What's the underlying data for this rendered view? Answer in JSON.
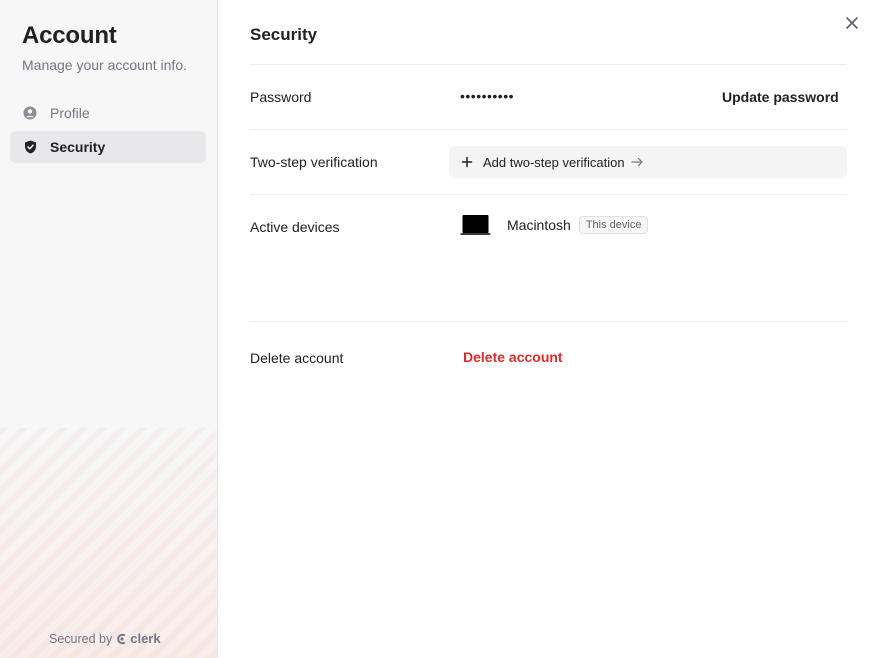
{
  "sidebar": {
    "title": "Account",
    "subtitle": "Manage your account info.",
    "items": [
      {
        "label": "Profile",
        "icon": "user-circle-icon",
        "active": false
      },
      {
        "label": "Security",
        "icon": "shield-icon",
        "active": true
      }
    ],
    "footer": {
      "prefix": "Secured by",
      "brand": "clerk"
    }
  },
  "main": {
    "title": "Security",
    "password": {
      "label": "Password",
      "value": "••••••••••",
      "action": "Update password"
    },
    "two_step": {
      "label": "Two-step verification",
      "action": "Add two-step verification"
    },
    "devices": {
      "label": "Active devices",
      "items": [
        {
          "name": "Macintosh",
          "badge": "This device",
          "icon": "laptop-icon"
        }
      ]
    },
    "delete": {
      "label": "Delete account",
      "action": "Delete account"
    }
  },
  "colors": {
    "accent_danger": "#d92d2d",
    "text_primary": "#212126",
    "text_secondary": "#747686",
    "active_bg": "#e8e8ea"
  }
}
